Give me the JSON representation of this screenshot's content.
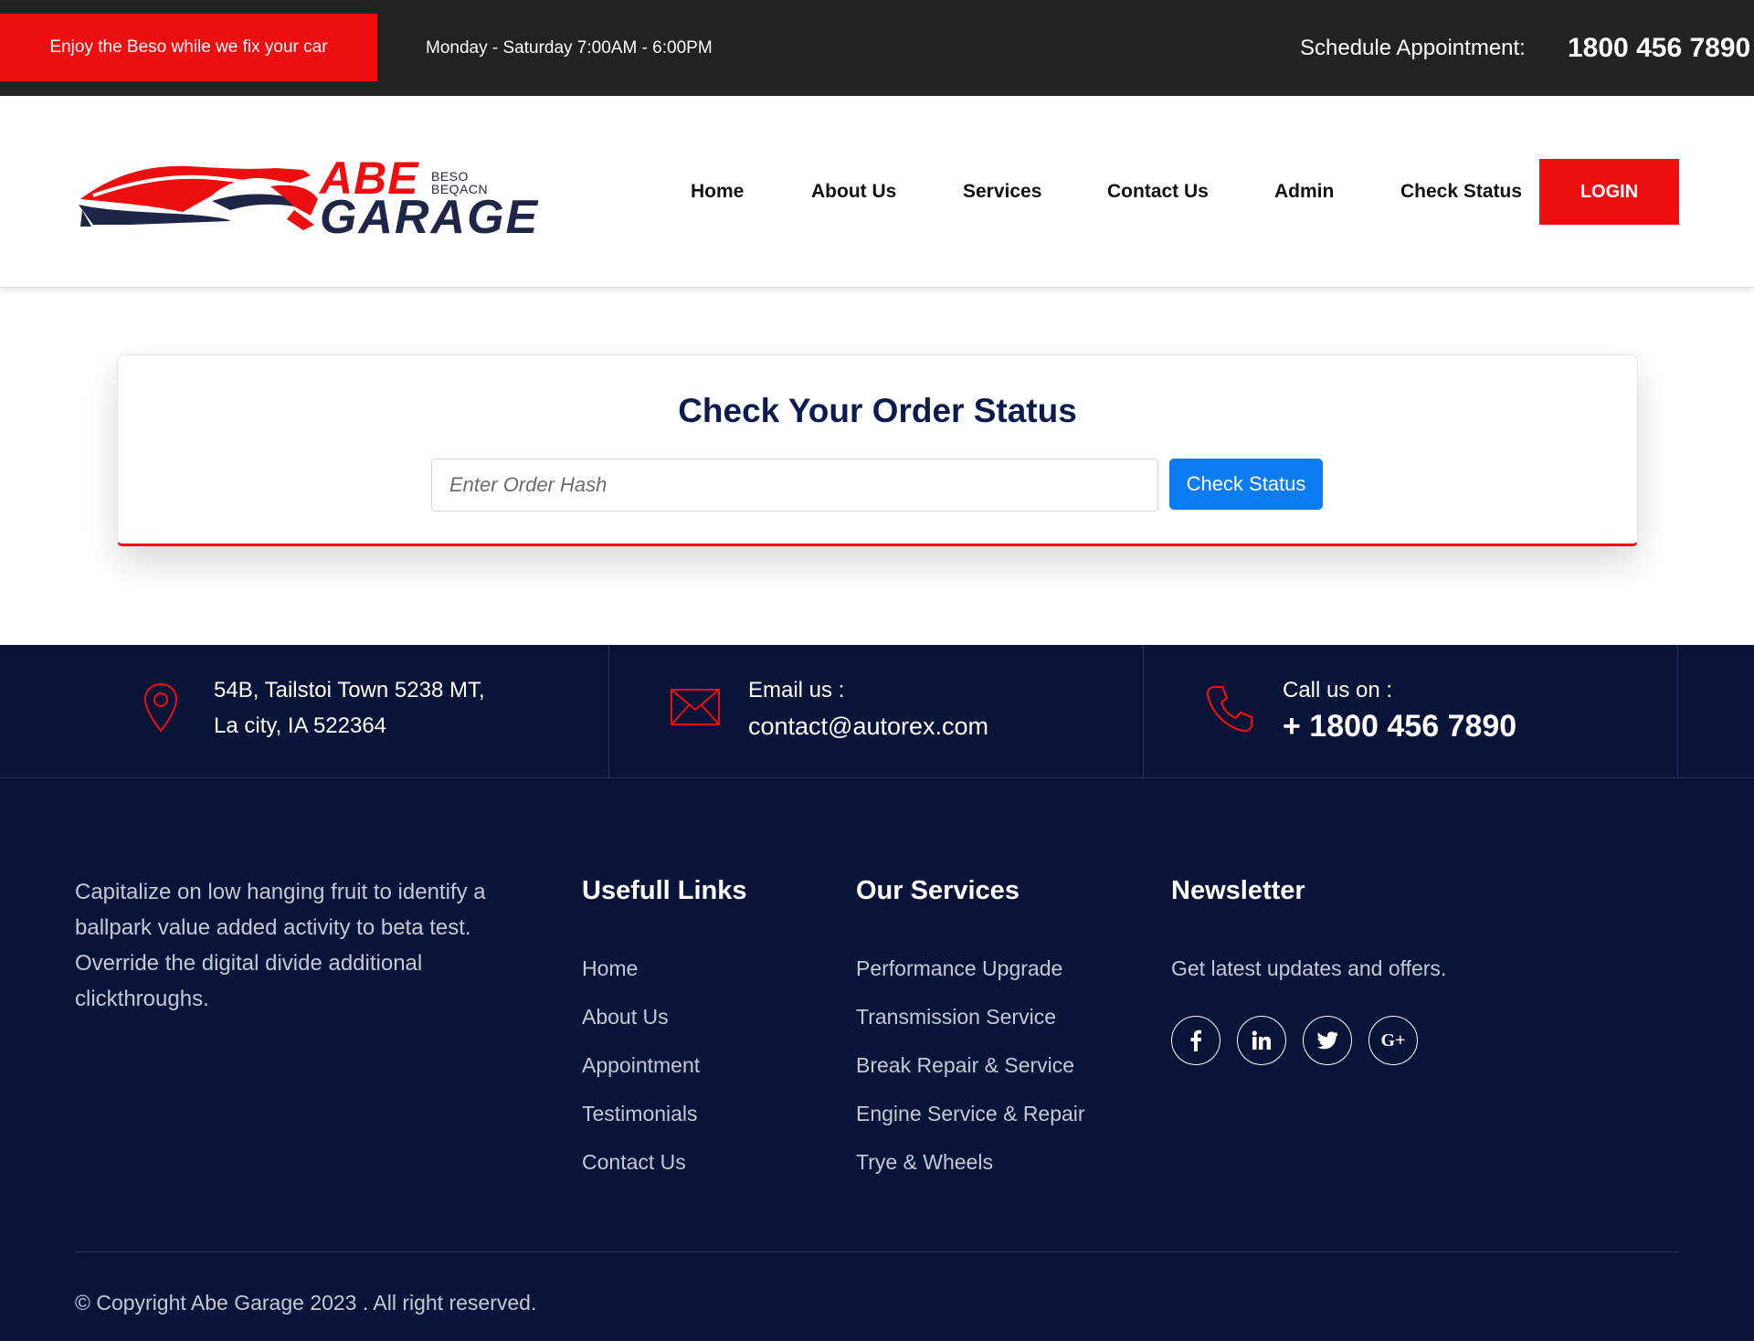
{
  "topbar": {
    "promo": "Enjoy the Beso while we fix your car",
    "hours": "Monday - Saturday 7:00AM - 6:00PM",
    "schedule_label": "Schedule Appointment:",
    "phone": "1800 456 7890"
  },
  "header": {
    "logo": {
      "word1": "ABE",
      "word2": "GARAGE",
      "tagline": "BESO BEQACN"
    },
    "nav": [
      "Home",
      "About Us",
      "Services",
      "Contact Us",
      "Admin",
      "Check Status"
    ],
    "login_label": "LOGIN"
  },
  "status_card": {
    "title": "Check Your Order Status",
    "input_placeholder": "Enter Order Hash",
    "input_value": "",
    "button_label": "Check Status"
  },
  "contact_strip": {
    "address_line1": "54B, Tailstoi Town 5238 MT,",
    "address_line2": "La city, IA 522364",
    "email_label": "Email us :",
    "email": "contact@autorex.com",
    "call_label": "Call us on :",
    "call_number": "+ 1800 456 7890",
    "icons": [
      "map-pin-icon",
      "envelope-icon",
      "phone-icon"
    ]
  },
  "footer": {
    "about": "Capitalize on low hanging fruit to identify a ballpark value added activity to beta test. Override the digital divide additional clickthroughs.",
    "links_title": "Usefull Links",
    "links": [
      "Home",
      "About Us",
      "Appointment",
      "Testimonials",
      "Contact Us"
    ],
    "services_title": "Our Services",
    "services": [
      "Performance Upgrade",
      "Transmission Service",
      "Break Repair & Service",
      "Engine Service & Repair",
      "Trye & Wheels"
    ],
    "newsletter_title": "Newsletter",
    "newsletter_text": "Get latest updates and offers.",
    "social": [
      "facebook-icon",
      "linkedin-icon",
      "twitter-icon",
      "google-plus-icon"
    ],
    "copyright": "© Copyright Abe Garage 2023 . All right reserved."
  },
  "colors": {
    "brand_red": "#ee0d0f",
    "navy": "#0a1439",
    "topbar": "#222222",
    "button_blue": "#0c7cf5",
    "title_navy": "#0b1b4d"
  }
}
